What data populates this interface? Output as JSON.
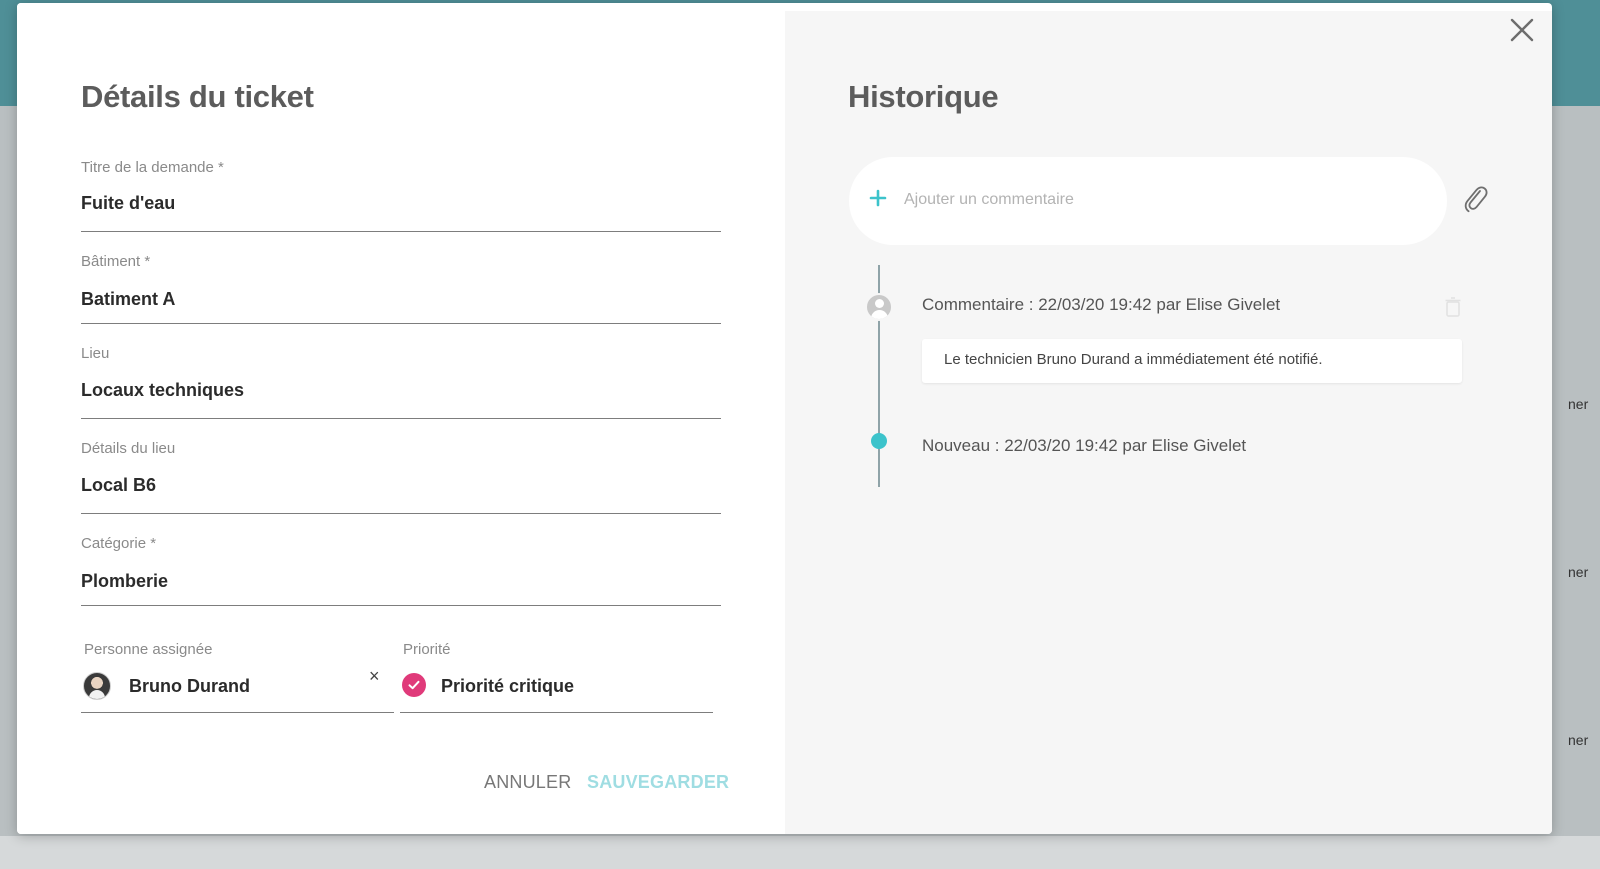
{
  "backdrop": {
    "side_fragments": [
      "ner",
      "ner",
      "ner"
    ]
  },
  "details": {
    "title": "Détails du ticket",
    "fields": [
      {
        "label": "Titre de la demande *",
        "value": "Fuite d'eau"
      },
      {
        "label": "Bâtiment *",
        "value": "Batiment A"
      },
      {
        "label": "Lieu",
        "value": "Locaux techniques"
      },
      {
        "label": "Détails du lieu",
        "value": "Local B6"
      },
      {
        "label": "Catégorie *",
        "value": "Plomberie"
      }
    ],
    "assignee": {
      "label": "Personne assignée",
      "value": "Bruno Durand",
      "clear_glyph": "×"
    },
    "priority": {
      "label": "Priorité",
      "value": "Priorité critique"
    },
    "cancel_label": "ANNULER",
    "save_label": "SAUVEGARDER"
  },
  "history": {
    "title": "Historique",
    "comment_placeholder": "Ajouter un commentaire",
    "entries": [
      {
        "header": "Commentaire : 22/03/20 19:42 par Elise Givelet",
        "body": "Le technicien Bruno Durand a immédiatement été notifié."
      },
      {
        "header": "Nouveau : 22/03/20 19:42 par Elise Givelet"
      }
    ]
  },
  "icons": {
    "close": "close-icon",
    "add": "plus-icon",
    "attach": "paperclip-icon",
    "delete": "trash-icon",
    "check": "check-icon"
  },
  "colors": {
    "accent": "#3cc3cb",
    "save_text": "#9fdde2",
    "priority_critical": "#e03a7a",
    "title_text": "#5c5c5c",
    "header_backdrop": "#4f8f97"
  }
}
